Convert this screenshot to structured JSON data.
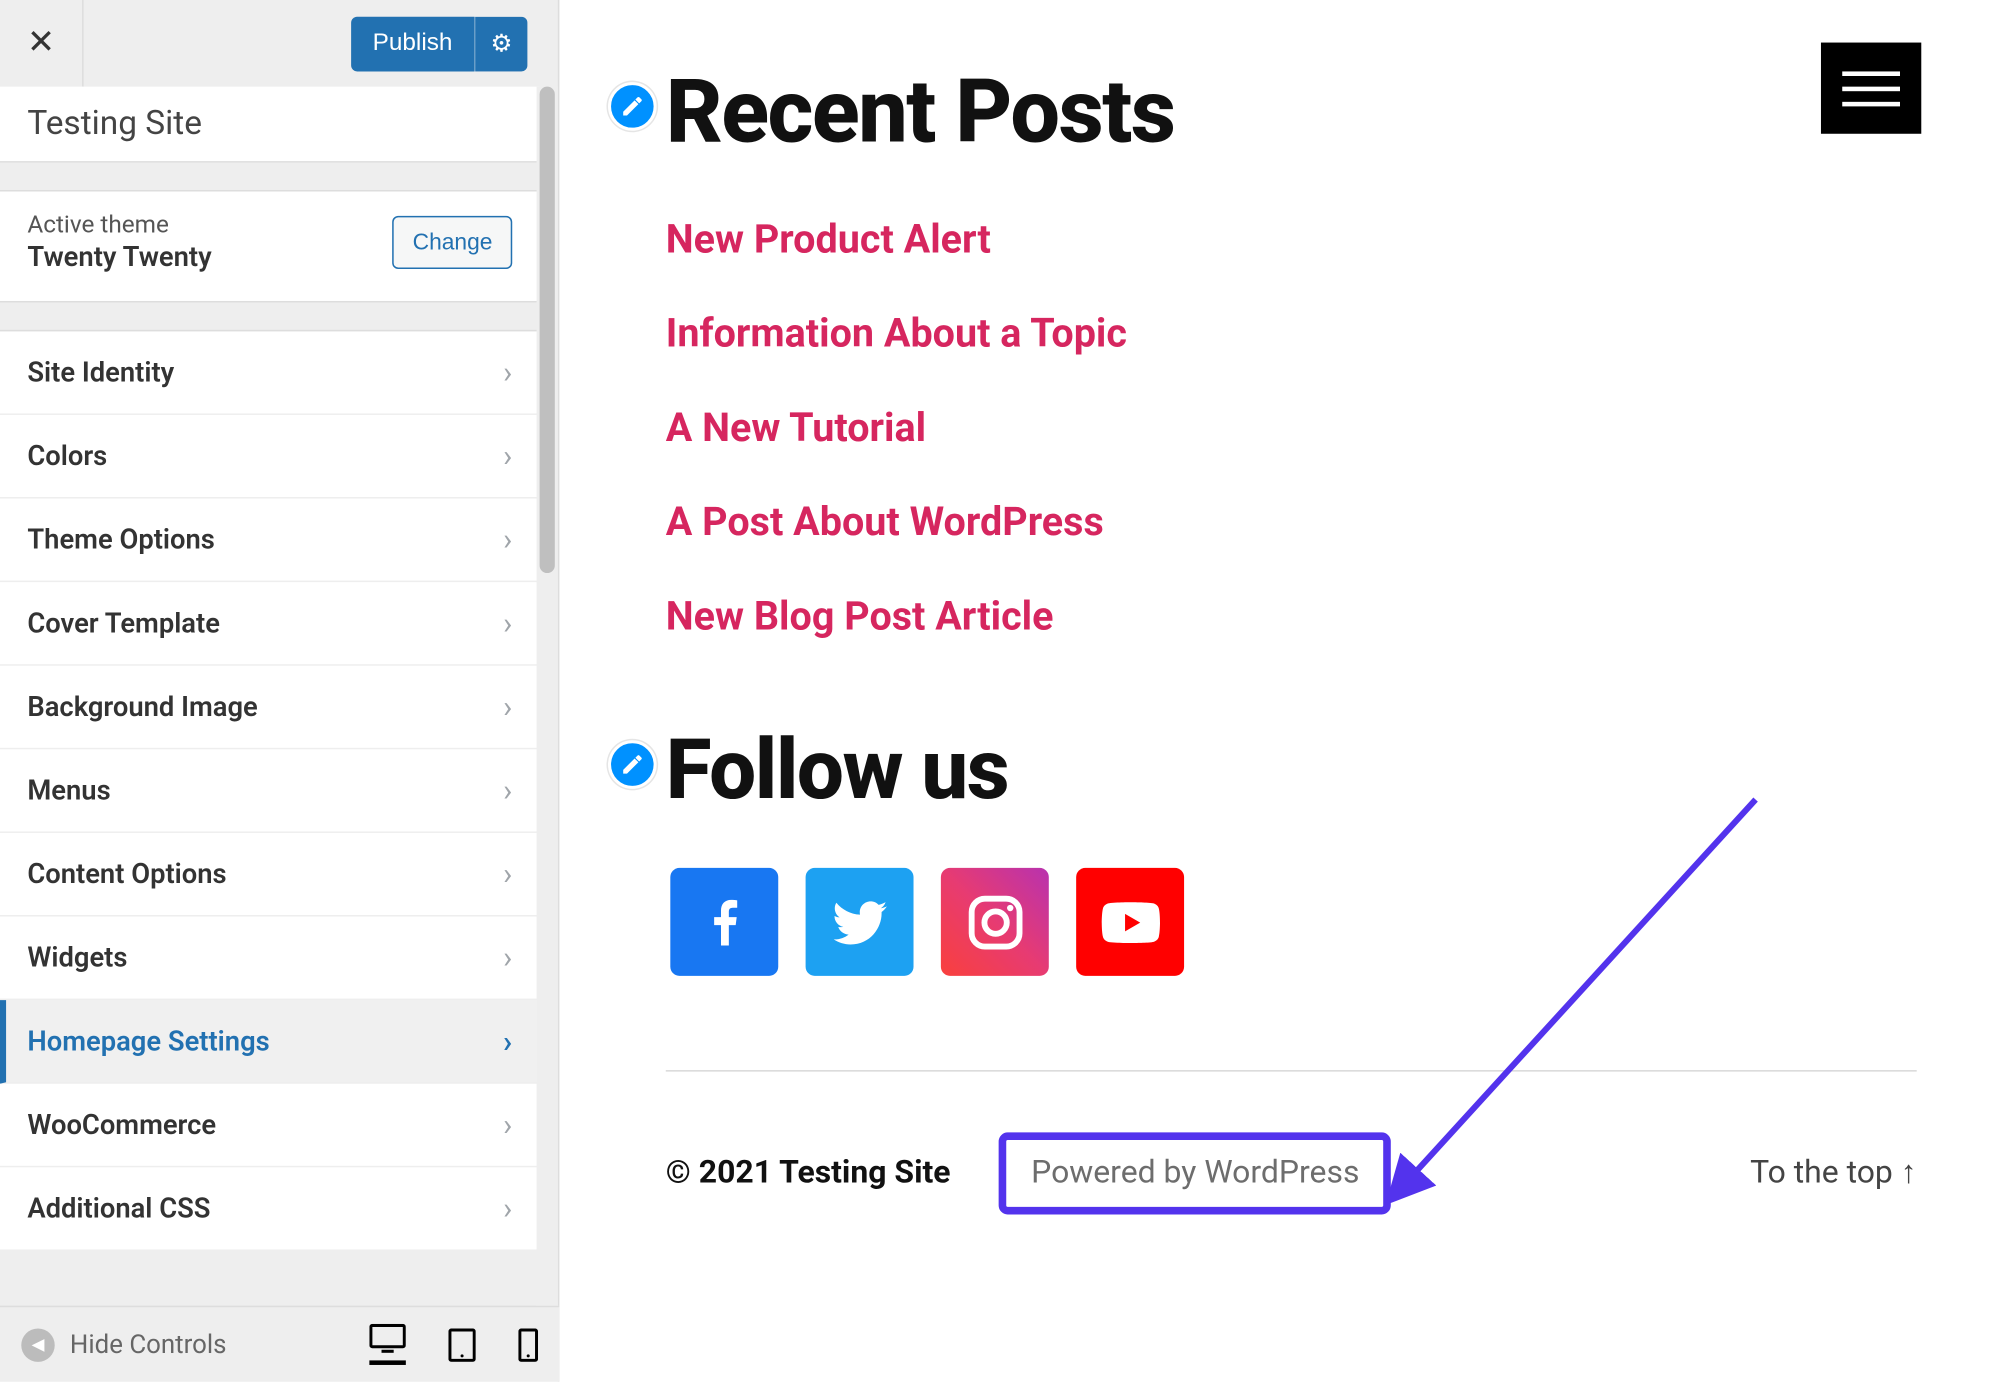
{
  "customizer": {
    "close_label": "✕",
    "publish_label": "Publish",
    "gear_glyph": "⚙",
    "site_name": "Testing Site",
    "active_theme_label": "Active theme",
    "active_theme_name": "Twenty Twenty",
    "change_button": "Change",
    "items": [
      {
        "label": "Site Identity"
      },
      {
        "label": "Colors"
      },
      {
        "label": "Theme Options"
      },
      {
        "label": "Cover Template"
      },
      {
        "label": "Background Image"
      },
      {
        "label": "Menus"
      },
      {
        "label": "Content Options"
      },
      {
        "label": "Widgets"
      },
      {
        "label": "Homepage Settings",
        "active": true
      },
      {
        "label": "WooCommerce"
      },
      {
        "label": "Additional CSS"
      }
    ],
    "hide_controls_label": "Hide Controls",
    "hide_arrow_glyph": "◄"
  },
  "preview": {
    "recent_posts_heading": "Recent Posts",
    "posts": [
      "New Product Alert",
      "Information About a Topic",
      "A New Tutorial",
      "A Post About WordPress",
      "New Blog Post Article"
    ],
    "follow_heading": "Follow us",
    "copyright": "© 2021 Testing Site",
    "powered_by": "Powered by WordPress",
    "to_top": "To the top ↑"
  }
}
